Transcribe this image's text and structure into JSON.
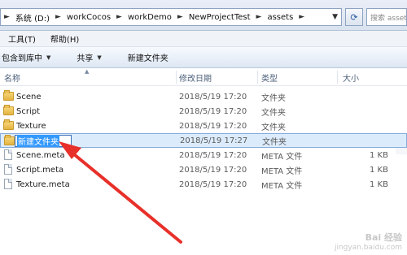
{
  "address": {
    "crumbs": [
      "系统 (D:)",
      "workCocos",
      "workDemo",
      "NewProjectTest",
      "assets"
    ],
    "search_placeholder": "搜索 assets"
  },
  "menu": [
    "工具(T)",
    "帮助(H)"
  ],
  "commands": [
    "包含到库中",
    "共享",
    "新建文件夹"
  ],
  "columns": {
    "name": "名称",
    "date": "修改日期",
    "type": "类型",
    "size": "大小"
  },
  "files": [
    {
      "name": "Scene",
      "date": "2018/5/19 17:20",
      "type": "文件夹",
      "size": "",
      "kind": "folder"
    },
    {
      "name": "Script",
      "date": "2018/5/19 17:20",
      "type": "文件夹",
      "size": "",
      "kind": "folder"
    },
    {
      "name": "Texture",
      "date": "2018/5/19 17:20",
      "type": "文件夹",
      "size": "",
      "kind": "folder"
    },
    {
      "name": "新建文件夹",
      "date": "2018/5/19 17:27",
      "type": "文件夹",
      "size": "",
      "kind": "folder",
      "renaming": true
    },
    {
      "name": "Scene.meta",
      "date": "2018/5/19 17:20",
      "type": "META 文件",
      "size": "1 KB",
      "kind": "file"
    },
    {
      "name": "Script.meta",
      "date": "2018/5/19 17:20",
      "type": "META 文件",
      "size": "1 KB",
      "kind": "file"
    },
    {
      "name": "Texture.meta",
      "date": "2018/5/19 17:20",
      "type": "META 文件",
      "size": "1 KB",
      "kind": "file"
    }
  ],
  "colors": {
    "selection": "#dcebfc",
    "arrow": "#e8302a",
    "highlight": "#3399ff"
  },
  "watermark": {
    "line1": "Bai 经验",
    "line2": "jingyan.baidu.com"
  }
}
